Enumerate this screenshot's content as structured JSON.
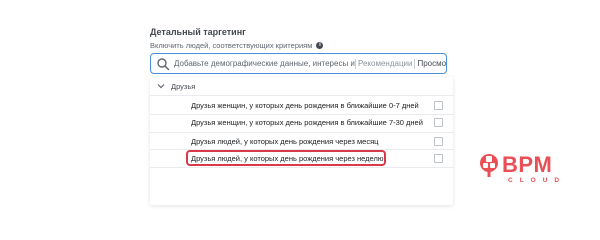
{
  "section": {
    "title": "Детальный таргетинг",
    "subtitle": "Включить людей, соответствующих критериям",
    "info_icon": "info-icon"
  },
  "search": {
    "placeholder": "Добавьте демографические данные, интересы и",
    "value": "",
    "recommendations_label": "Рекомендации",
    "browse_label": "Просмотр"
  },
  "dropdown": {
    "category_label": "Друзья",
    "items": [
      {
        "label": "Друзья женщин, у которых день рождения в ближайшие 0-7 дней",
        "checked": false
      },
      {
        "label": "Друзья женщин, у которых день рождения в ближайшие 7-30 дней",
        "checked": false
      },
      {
        "label": "Друзья людей, у которых день рождения через месяц",
        "checked": false
      },
      {
        "label": "Друзья людей, у которых день рождения через неделю",
        "checked": false,
        "highlighted": true
      }
    ]
  },
  "branding": {
    "logo_text": "BPM",
    "logo_subtext": "CLOUD",
    "color": "#ea4f56"
  },
  "colors": {
    "accent": "#4a90d9",
    "highlight": "#d93a4a"
  }
}
